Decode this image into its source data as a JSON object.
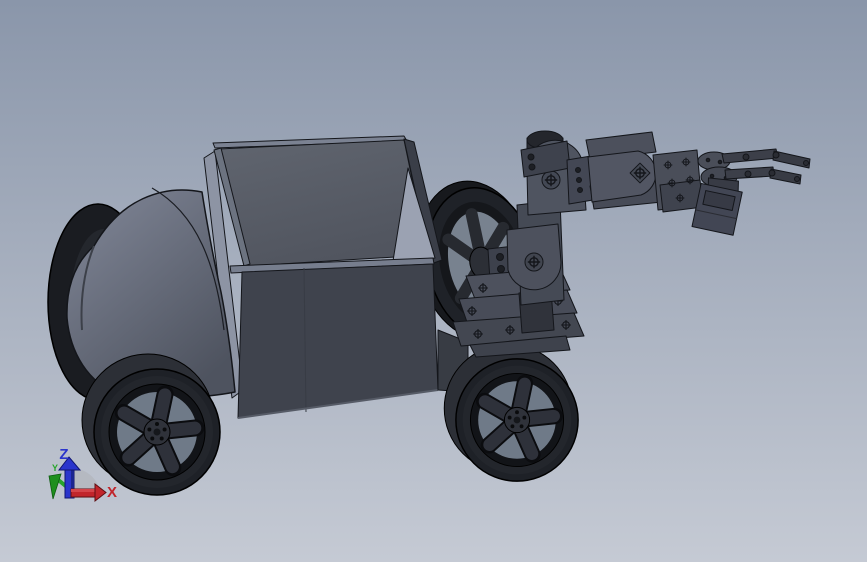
{
  "viewport": {
    "orientation_triad": {
      "z_label": "Z",
      "x_label": "X",
      "y_label": "Y"
    },
    "colors": {
      "bg-top": "#8a96aa",
      "bg-bottom": "#c5cad4",
      "axis-z": "#2a35cc",
      "axis-x": "#c1252b",
      "axis-y": "#27a52b",
      "body-light": "#828899",
      "body-dark": "#4e535f",
      "panel-dark": "#3f434d",
      "box-interior": "#585d68",
      "wall-light": "#8d94a4",
      "tire": "#1e2127",
      "rim-gap": "#6f7a88",
      "arm": "#4a4e59",
      "arm-dark": "#3e424d",
      "edge": "#14161b"
    }
  }
}
